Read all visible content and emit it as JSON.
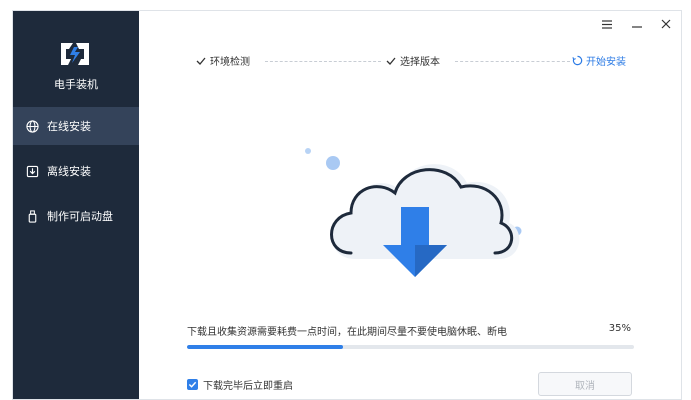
{
  "app": {
    "title": "电手装机"
  },
  "sidebar": {
    "items": [
      {
        "label": "在线安装",
        "icon": "globe-icon",
        "active": true
      },
      {
        "label": "离线安装",
        "icon": "download-box-icon",
        "active": false
      },
      {
        "label": "制作可启动盘",
        "icon": "usb-drive-icon",
        "active": false
      }
    ]
  },
  "steps": [
    {
      "label": "环境检测",
      "state": "done"
    },
    {
      "label": "选择版本",
      "state": "done"
    },
    {
      "label": "开始安装",
      "state": "current"
    }
  ],
  "progress": {
    "message": "下载且收集资源需要耗费一点时间，在此期间尽量不要使电脑休眠、断电",
    "percent_text": "35%",
    "value": 0.35
  },
  "options": {
    "reboot_label": "下载完毕后立即重启",
    "reboot_checked": true
  },
  "buttons": {
    "cancel_label": "取消"
  },
  "colors": {
    "accent": "#2f7fe8",
    "sidebar_bg": "#1e2a3b",
    "sidebar_active": "#34435a"
  }
}
